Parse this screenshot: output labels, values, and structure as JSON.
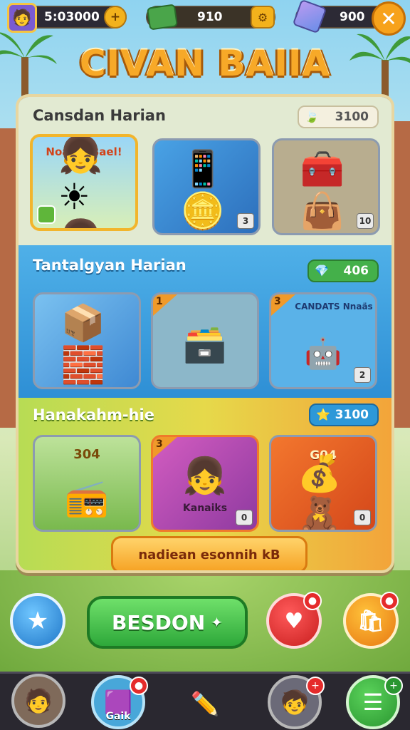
{
  "topbar": {
    "coins": "5:03000",
    "coins_plus": "+",
    "cash": "910",
    "gems": "900",
    "close": "✕"
  },
  "title": "CIVAN BAIIA",
  "sections": {
    "daily_rewards": {
      "title": "Cansdan Harian",
      "badge": "3100",
      "cards": [
        {
          "label": "Noaaik Bael!",
          "num": ""
        },
        {
          "label": "",
          "num": "3"
        },
        {
          "label": "",
          "num": "10"
        }
      ]
    },
    "daily_challenge": {
      "title": "Tantalgyan Harian",
      "badge": "406",
      "cards": [
        {
          "label": "",
          "num": ""
        },
        {
          "label": "",
          "corner": "1",
          "num": ""
        },
        {
          "label": "CANDATS Nnaäs",
          "corner": "3",
          "num": "2"
        }
      ]
    },
    "bonus": {
      "title": "Hanakahm-hie",
      "badge": "3100",
      "cards": [
        {
          "label": "304",
          "num": ""
        },
        {
          "label": "Kanaiks",
          "corner": "3",
          "num": "0"
        },
        {
          "label": "G04",
          "num": "0"
        }
      ]
    }
  },
  "wide_button": "nadiean esonnih kB",
  "main_button": "BESDON",
  "bottom_nav": {
    "item2_label": "Gaik"
  }
}
